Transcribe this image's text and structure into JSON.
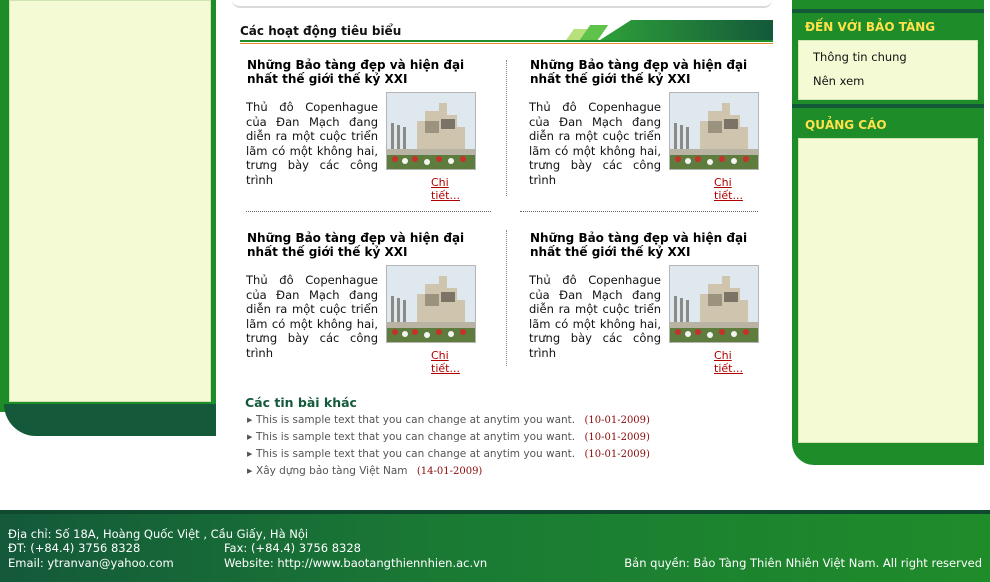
{
  "highlights": {
    "title": "Các hoạt động tiêu biểu",
    "cards": [
      {
        "title": "Những Bảo tàng đẹp và hiện đại nhất thế giới thế kỷ XXI",
        "text": "Thủ đô Copenhague của Đan Mạch đang diễn ra một cuộc triển lãm có một không hai, trưng bày các công trình",
        "more": "Chi tiết..."
      },
      {
        "title": "Những Bảo tàng đẹp và hiện đại nhất thế giới thế kỷ XXI",
        "text": "Thủ đô Copenhague của Đan Mạch đang diễn ra một cuộc triển lãm có một không hai, trưng bày các công trình",
        "more": "Chi tiết..."
      },
      {
        "title": "Những Bảo tàng đẹp và hiện đại nhất thế giới thế kỷ XXI",
        "text": "Thủ đô Copenhague của Đan Mạch đang diễn ra một cuộc triển lãm có một không hai, trưng bày các công trình",
        "more": "Chi tiết..."
      },
      {
        "title": "Những Bảo tàng đẹp và hiện đại nhất thế giới thế kỷ XXI",
        "text": "Thủ đô Copenhague của Đan Mạch đang diễn ra một cuộc triển lãm có một không hai, trưng bày các công trình",
        "more": "Chi tiết..."
      }
    ]
  },
  "other_news": {
    "title": "Các tin bài khác",
    "items": [
      {
        "text": "This is sample text that you can change at anytim you want.",
        "date": "(10-01-2009)"
      },
      {
        "text": "This is sample text that you can change at anytim you want.",
        "date": "(10-01-2009)"
      },
      {
        "text": "This is sample text that you can change at anytim you want.",
        "date": "(10-01-2009)"
      },
      {
        "text": "Xây dựng bảo tàng Việt Nam",
        "date": "(14-01-2009)"
      }
    ]
  },
  "sidebar_right": {
    "museum_title": "ĐẾN VỚI BẢO TÀNG",
    "links": [
      "Thông tin chung",
      "Nên xem"
    ],
    "ads_title": "QUẢNG CÁO"
  },
  "footer": {
    "address": "Địa chỉ: Số 18A, Hoàng Quốc Việt , Cầu Giấy, Hà Nội",
    "phone": "ĐT:  (+84.4) 3756 8328",
    "fax": "Fax: (+84.4) 3756 8328",
    "email": "Email: ytranvan@yahoo.com",
    "website": "Website: http://www.baotangthiennhien.ac.vn",
    "copyright": "Bản quyền: Bảo Tàng Thiên Nhiên Việt Nam. All right reserved"
  },
  "colors": {
    "brand_green": "#1f8c2a",
    "dark_green": "#14593a",
    "panel_bg": "#f4fbd4",
    "sidebar_title": "#ffe24a",
    "link_red": "#b00000"
  }
}
